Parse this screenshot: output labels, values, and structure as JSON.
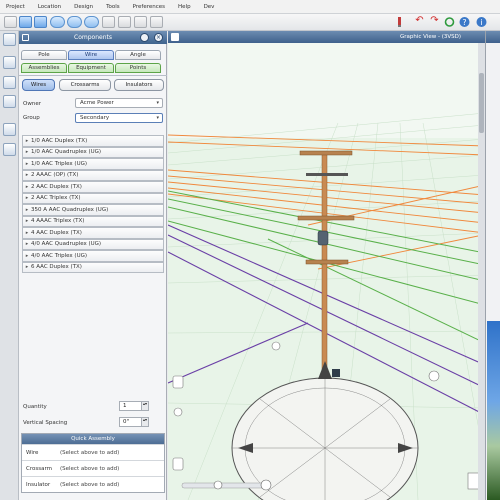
{
  "menu": [
    "Project",
    "Location",
    "Design",
    "Tools",
    "Preferences",
    "Help",
    "Dev"
  ],
  "panel": {
    "title": "Components",
    "close": "×",
    "tabs_row1": [
      "Pole",
      "Wire",
      "Angle"
    ],
    "tabs_row2": [
      "Assemblies",
      "Equipment",
      "Points"
    ],
    "subtabs": [
      "Wires",
      "Crossarms",
      "Insulators"
    ],
    "owner_label": "Owner",
    "owner_value": "Acme Power",
    "group_label": "Group",
    "group_value": "Secondary",
    "wires": [
      "1/0 AAC Duplex (TX)",
      "1/0 AAC Quadruplex (UG)",
      "1/0 AAC Triplex (UG)",
      "2 AAAC (OP) (TX)",
      "2 AAC Duplex (TX)",
      "2 AAC Triplex (TX)",
      "350 A AAC Quadruplex (UG)",
      "4 AAAC Triplex (TX)",
      "4 AAC Duplex (TX)",
      "4/0 AAC Quadruplex (UG)",
      "4/0 AAC Triplex (UG)",
      "6 AAC Duplex (TX)"
    ],
    "quantity_label": "Quantity",
    "quantity_value": "1",
    "spacing_label": "Vertical Spacing",
    "spacing_value": "0\"",
    "quick_assembly": {
      "title": "Quick Assembly",
      "rows": [
        {
          "key": "Wire",
          "value": "(Select above to add)"
        },
        {
          "key": "Crossarm",
          "value": "(Select above to add)"
        },
        {
          "key": "Insulator",
          "value": "(Select above to add)"
        }
      ]
    }
  },
  "view": {
    "title": "Graphic View - (3VSD)"
  },
  "colors": {
    "header": "#3f618c",
    "orange_wire": "#f0883c",
    "green_wire": "#59b04a",
    "purple_wire": "#6a3fa6",
    "pole": "#c98a52"
  }
}
